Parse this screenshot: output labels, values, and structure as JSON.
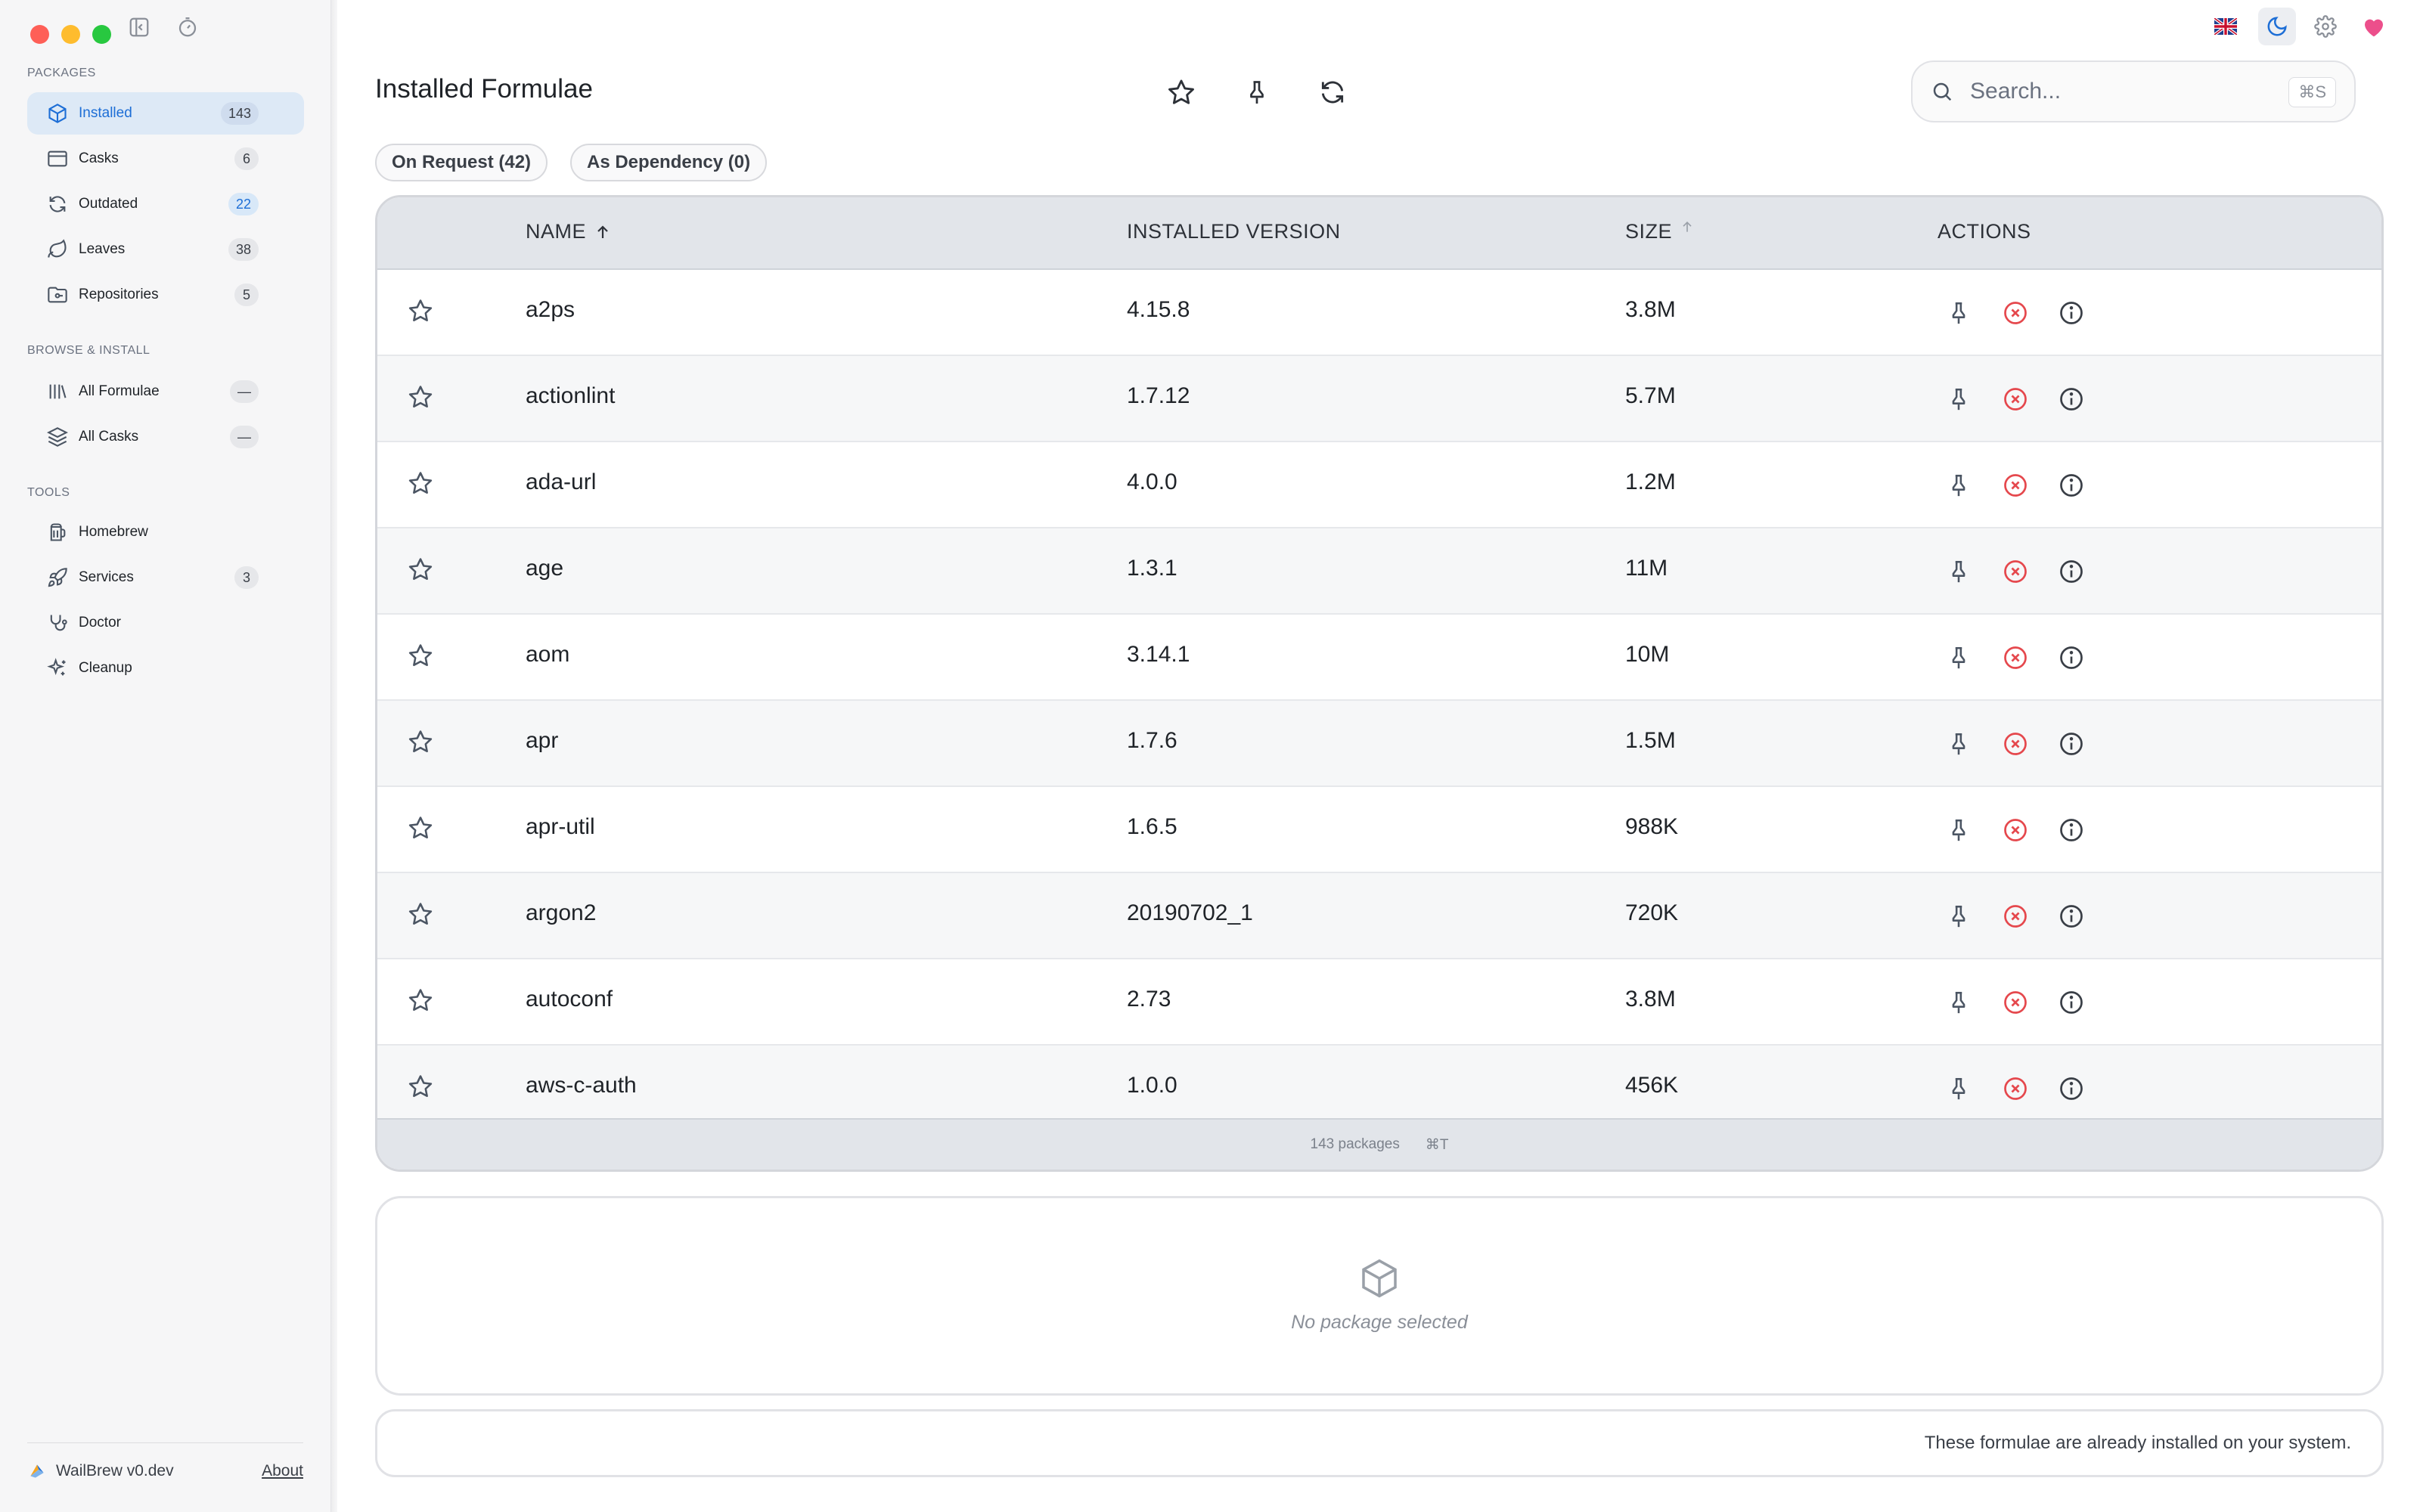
{
  "sidebar": {
    "sections": {
      "packages": "PACKAGES",
      "browse": "BROWSE & INSTALL",
      "tools": "TOOLS"
    },
    "items": [
      {
        "label": "Installed",
        "badge": "143"
      },
      {
        "label": "Casks",
        "badge": "6"
      },
      {
        "label": "Outdated",
        "badge": "22"
      },
      {
        "label": "Leaves",
        "badge": "38"
      },
      {
        "label": "Repositories",
        "badge": "5"
      },
      {
        "label": "All Formulae",
        "badge": "—"
      },
      {
        "label": "All Casks",
        "badge": "—"
      },
      {
        "label": "Homebrew",
        "badge": ""
      },
      {
        "label": "Services",
        "badge": "3"
      },
      {
        "label": "Doctor",
        "badge": ""
      },
      {
        "label": "Cleanup",
        "badge": ""
      }
    ],
    "footer": {
      "brand": "WailBrew v0.dev",
      "about": "About"
    }
  },
  "header": {
    "title": "Installed Formulae",
    "search_placeholder": "Search...",
    "search_shortcut": "⌘S"
  },
  "filters": {
    "on_request": "On Request (42)",
    "as_dependency": "As Dependency (0)"
  },
  "table": {
    "columns": {
      "name": "NAME",
      "version": "INSTALLED VERSION",
      "size": "SIZE",
      "actions": "ACTIONS"
    },
    "rows": [
      {
        "name": "a2ps",
        "version": "4.15.8",
        "size": "3.8M"
      },
      {
        "name": "actionlint",
        "version": "1.7.12",
        "size": "5.7M"
      },
      {
        "name": "ada-url",
        "version": "4.0.0",
        "size": "1.2M"
      },
      {
        "name": "age",
        "version": "1.3.1",
        "size": "11M"
      },
      {
        "name": "aom",
        "version": "3.14.1",
        "size": "10M"
      },
      {
        "name": "apr",
        "version": "1.7.6",
        "size": "1.5M"
      },
      {
        "name": "apr-util",
        "version": "1.6.5",
        "size": "988K"
      },
      {
        "name": "argon2",
        "version": "20190702_1",
        "size": "720K"
      },
      {
        "name": "autoconf",
        "version": "2.73",
        "size": "3.8M"
      },
      {
        "name": "aws-c-auth",
        "version": "1.0.0",
        "size": "456K"
      }
    ],
    "footer": {
      "count": "143 packages",
      "shortcut": "⌘T"
    }
  },
  "detail": {
    "empty": "No package selected"
  },
  "status": {
    "message": "These formulae are already installed on your system."
  },
  "colors": {
    "accent": "#1d6ed6",
    "remove": "#e5484d",
    "heart": "#ec4f8b"
  }
}
